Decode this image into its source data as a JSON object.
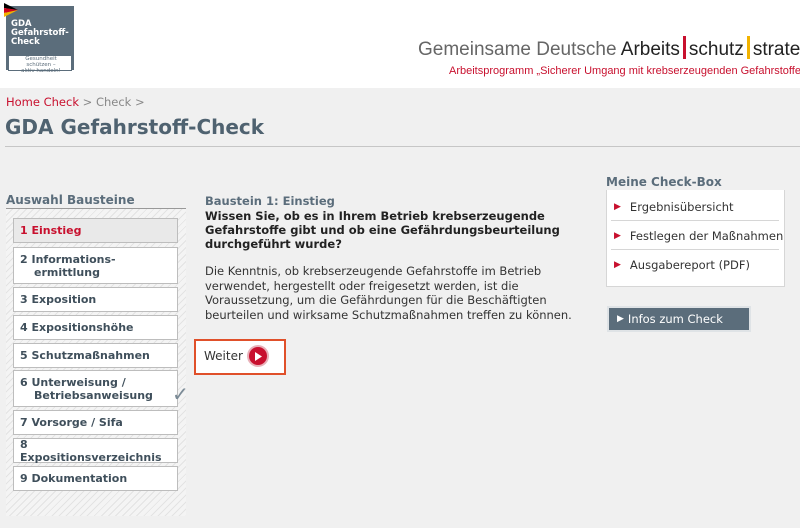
{
  "logo": {
    "line1": "GDA",
    "line2": "Gefahrstoff-",
    "line3": "Check",
    "tagline1": "Gesundheit",
    "tagline2": "schützen –",
    "tagline3": "aktiv handeln!"
  },
  "header": {
    "brand_prefix": "Gemeinsame Deutsche ",
    "brand_part1": "Arbeits",
    "brand_part2": "schutz",
    "brand_part3": "strategie",
    "subtitle": "Arbeitsprogramm „Sicherer Umgang mit krebserzeugenden Gefahrstoffen“",
    "colors": {
      "black": "#000000",
      "red": "#c8102e",
      "gold": "#f2b300"
    }
  },
  "breadcrumb": {
    "home": "Home Check",
    "sep1": ">",
    "current": "Check",
    "sep2": ">"
  },
  "page_title": "GDA Gefahrstoff-Check",
  "nav": {
    "heading": "Auswahl Bausteine",
    "items": [
      {
        "label": "1 Einstieg",
        "active": true
      },
      {
        "label": "2 Informations-",
        "label2": "ermittlung"
      },
      {
        "label": "3 Exposition"
      },
      {
        "label": "4 Expositionshöhe"
      },
      {
        "label": "5 Schutzmaßnahmen"
      },
      {
        "label": "6 Unterweisung /",
        "label2": "Betriebsanweisung",
        "checked": true
      },
      {
        "label": "7 Vorsorge / Sifa"
      },
      {
        "label": "8 Expositionsverzeichnis"
      },
      {
        "label": "9 Dokumentation"
      }
    ],
    "check_icon": "check-mark-icon"
  },
  "main": {
    "baustein_title": "Baustein 1: Einstieg",
    "question": "Wissen Sie, ob es in Ihrem Betrieb krebserzeugende Gefahrstoffe gibt und ob eine Gefährdungsbeurteilung durchgeführt wurde?",
    "paragraph": "Die Kenntnis, ob krebserzeugende Gefahrstoffe im Betrieb verwendet, hergestellt oder freigesetzt werden, ist die Voraussetzung, um die Gefährdungen für die Beschäftigten beurteilen und wirksame Schutzmaßnahmen treffen zu können.",
    "weiter_label": "Weiter",
    "weiter_icon": "play-circle-icon"
  },
  "checkbox": {
    "heading": "Meine Check-Box",
    "items": [
      "Ergebnisübersicht",
      "Festlegen der Maßnahmen",
      "Ausgabereport (PDF)"
    ],
    "infos_label": "Infos zum Check"
  },
  "colors": {
    "accent_red": "#c8102e",
    "slate": "#5b6d7b",
    "highlight_border": "#e0502a"
  }
}
